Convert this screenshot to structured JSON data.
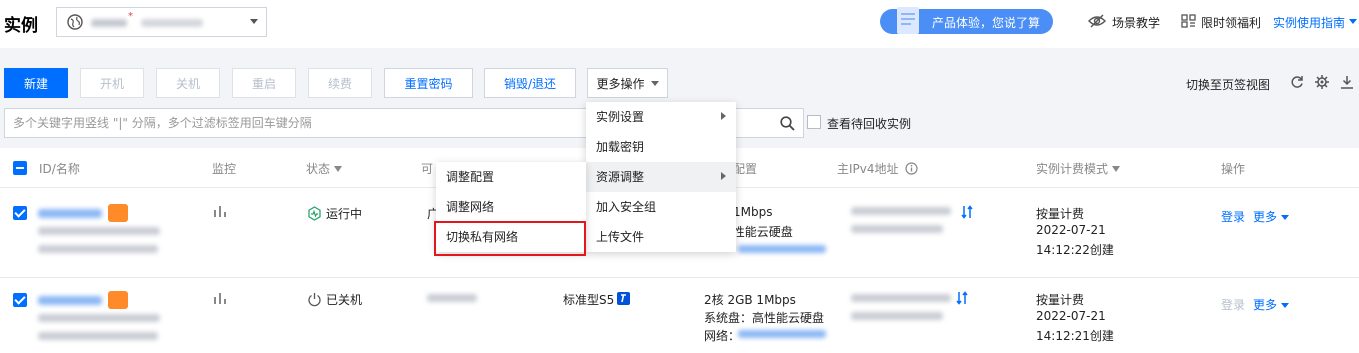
{
  "header": {
    "title": "实例",
    "region_star": "*",
    "experience_label": "产品体验，您说了算",
    "scene_teaching": "场景教学",
    "limited_benefit": "限时领福利",
    "guide": "实例使用指南"
  },
  "toolbar": {
    "new": "新建",
    "start": "开机",
    "shutdown": "关机",
    "restart": "重启",
    "renew": "续费",
    "reset_password": "重置密码",
    "destroy": "销毁/退还",
    "more_ops": "更多操作",
    "switch_view": "切换至页签视图"
  },
  "search": {
    "placeholder": "多个关键字用竖线 \"|\" 分隔，多个过滤标签用回车键分隔",
    "recycle_label": "查看待回收实例"
  },
  "table": {
    "headers": {
      "id_name": "ID/名称",
      "monitor": "监控",
      "status": "状态",
      "zone": "可",
      "config": "配置",
      "ipv4": "主IPv4地址",
      "billing": "实例计费模式",
      "actions": "操作"
    },
    "rows": [
      {
        "status": "运行中",
        "zone_prefix": "广",
        "config_line1": "2GB 1Mbps",
        "config_line2": "t：高性能云硬盘",
        "billing": "按量计费",
        "date": "2022-07-21",
        "created": "14:12:22创建",
        "login": "登录",
        "more": "更多"
      },
      {
        "status": "已关机",
        "type": "标准型S5",
        "config_line1": "2核 2GB 1Mbps",
        "config_line2": "系统盘：高性能云硬盘",
        "config_line3": "网络：",
        "billing": "按量计费",
        "date": "2022-07-21",
        "created": "14:12:21创建",
        "login": "登录",
        "more": "更多"
      }
    ]
  },
  "more_menu": {
    "items": [
      "实例设置",
      "加载密钥",
      "资源调整",
      "加入安全组",
      "上传文件"
    ]
  },
  "submenu": {
    "items": [
      "调整配置",
      "调整网络",
      "切换私有网络"
    ]
  },
  "colors": {
    "primary": "#006eff",
    "highlight": "#e0181c",
    "running": "#29a36a",
    "tag": "#ff8a2a"
  }
}
